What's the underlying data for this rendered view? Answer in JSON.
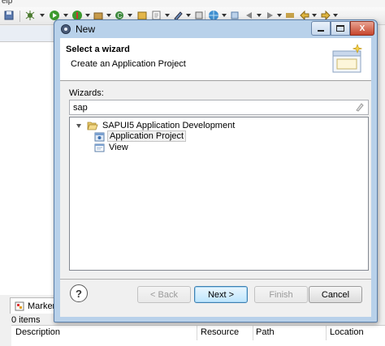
{
  "ide": {
    "menu_fragment": "elp",
    "markers": {
      "tab_label": "Markers",
      "count": "0 items",
      "columns": [
        "Description",
        "Resource",
        "Path",
        "Location"
      ]
    }
  },
  "dialog": {
    "title": "New",
    "header": {
      "title": "Select a wizard",
      "subtitle": "Create an Application Project"
    },
    "wizards_label": "Wizards:",
    "filter": {
      "value": "sap",
      "placeholder": ""
    },
    "tree": {
      "root": {
        "label": "SAPUI5 Application Development",
        "expanded": true
      },
      "children": [
        {
          "label": "Application Project",
          "selected": true
        },
        {
          "label": "View",
          "selected": false
        }
      ]
    },
    "buttons": {
      "help": "?",
      "back": "< Back",
      "next": "Next >",
      "finish": "Finish",
      "cancel": "Cancel"
    },
    "window_controls": {
      "minimize": "",
      "maximize": "",
      "close": "X"
    }
  },
  "colors": {
    "dialog_frame": "#b8d1ea",
    "selection_bg": "#f2f2f2",
    "default_button": "#3c7fb1",
    "close_button": "#c7452c"
  }
}
